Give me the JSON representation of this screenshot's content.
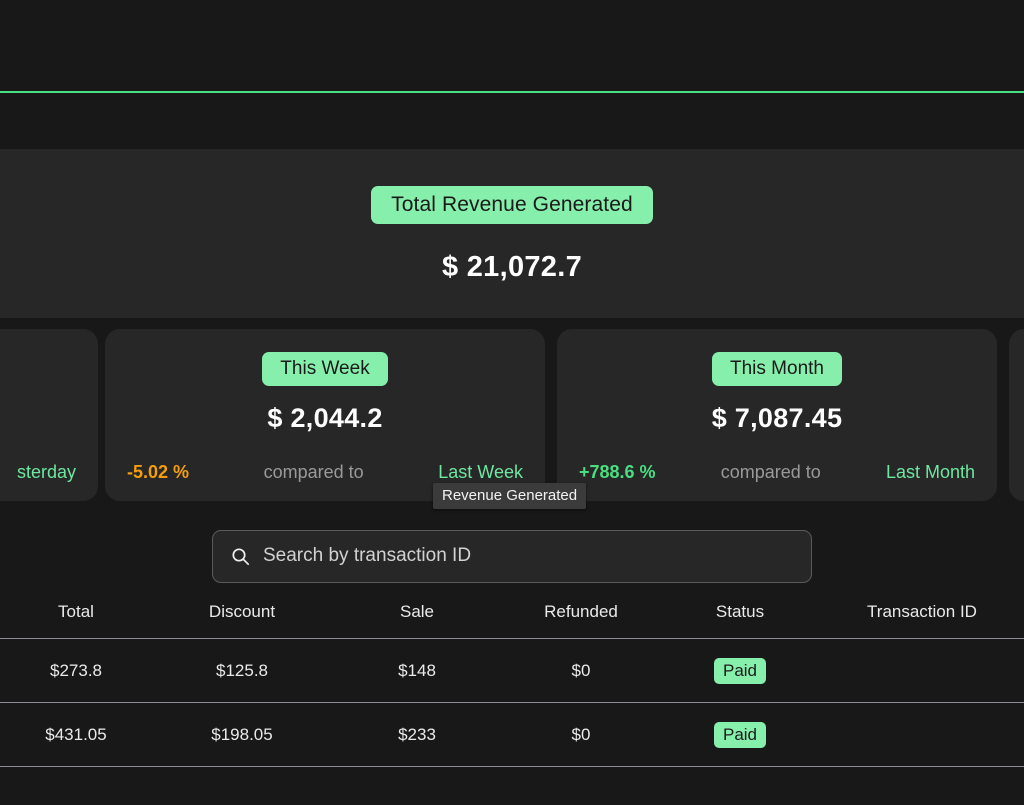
{
  "theme": {
    "page_bg": "#181818",
    "panel_bg": "#272727",
    "accent_green": "#86efac",
    "positive_green": "#4ade80",
    "negative_orange": "#f59e0b",
    "divider_green": "#4ade80"
  },
  "total": {
    "label": "Total Revenue Generated",
    "amount": "$ 21,072.7"
  },
  "cards": [
    {
      "period_label": "Yesterday",
      "amount": "",
      "delta": "",
      "compare_text": "",
      "compare_period": "sterday",
      "direction": "up",
      "partial": true
    },
    {
      "period_label": "This Week",
      "amount": "$ 2,044.2",
      "delta": "-5.02 %",
      "compare_text": "compared to",
      "compare_period": "Last Week",
      "direction": "down",
      "partial": false
    },
    {
      "period_label": "This Month",
      "amount": "$ 7,087.45",
      "delta": "+788.6 %",
      "compare_text": "compared to",
      "compare_period": "Last Month",
      "direction": "up",
      "partial": false
    }
  ],
  "tooltip": {
    "text": "Revenue Generated"
  },
  "search": {
    "placeholder": "Search by transaction ID",
    "value": "",
    "icon": "search-icon"
  },
  "table": {
    "headers": [
      "Total",
      "Discount",
      "Sale",
      "Refunded",
      "Status",
      "Transaction ID"
    ],
    "rows": [
      {
        "total": "$273.8",
        "discount": "$125.8",
        "sale": "$148",
        "refunded": "$0",
        "status": "Paid",
        "transaction_id": ""
      },
      {
        "total": "$431.05",
        "discount": "$198.05",
        "sale": "$233",
        "refunded": "$0",
        "status": "Paid",
        "transaction_id": ""
      }
    ]
  }
}
